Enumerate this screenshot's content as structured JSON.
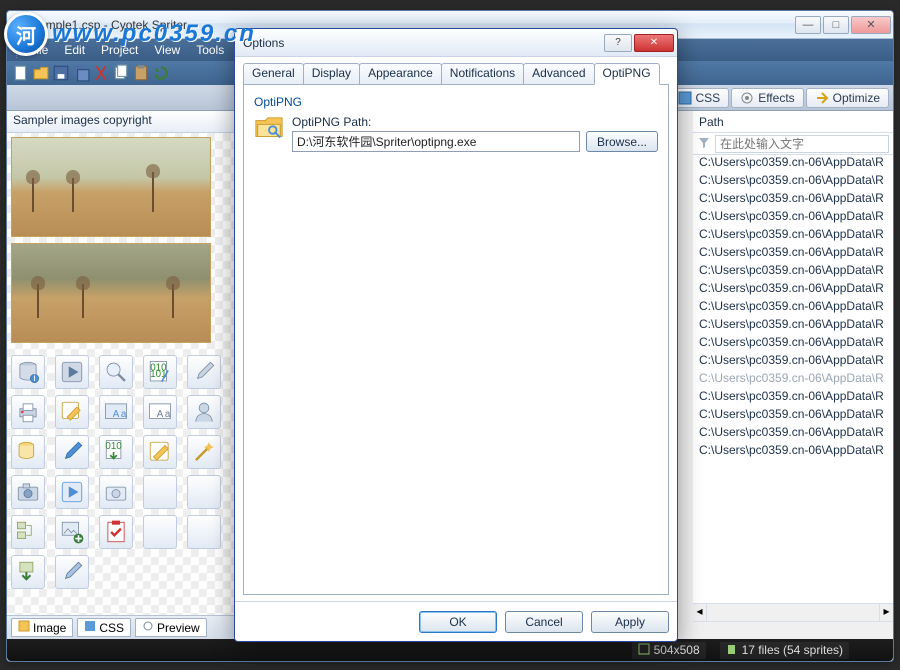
{
  "main_window": {
    "title": "sample1.csp - Cyotek Spriter",
    "win_min": "—",
    "win_max": "□",
    "win_close": "✕"
  },
  "watermark": {
    "url": "www.pc0359.cn",
    "logo_text": "河"
  },
  "menu": {
    "items": [
      "File",
      "Edit",
      "Project",
      "View",
      "Tools"
    ]
  },
  "ribbon": {
    "css": "CSS",
    "effects": "Effects",
    "optimize": "Optimize"
  },
  "left": {
    "panel_title": "Sampler images copyright",
    "tabs": {
      "image": "Image",
      "css": "CSS",
      "preview": "Preview"
    }
  },
  "right": {
    "header": "Path",
    "filter_placeholder": "在此处输入文字",
    "items": [
      {
        "text": "C:\\Users\\pc0359.cn-06\\AppData\\R"
      },
      {
        "text": "C:\\Users\\pc0359.cn-06\\AppData\\R"
      },
      {
        "text": "C:\\Users\\pc0359.cn-06\\AppData\\R"
      },
      {
        "text": "C:\\Users\\pc0359.cn-06\\AppData\\R"
      },
      {
        "text": "C:\\Users\\pc0359.cn-06\\AppData\\R"
      },
      {
        "text": "C:\\Users\\pc0359.cn-06\\AppData\\R"
      },
      {
        "text": "C:\\Users\\pc0359.cn-06\\AppData\\R"
      },
      {
        "text": "C:\\Users\\pc0359.cn-06\\AppData\\R"
      },
      {
        "text": "C:\\Users\\pc0359.cn-06\\AppData\\R"
      },
      {
        "text": "C:\\Users\\pc0359.cn-06\\AppData\\R"
      },
      {
        "text": "C:\\Users\\pc0359.cn-06\\AppData\\R"
      },
      {
        "text": "C:\\Users\\pc0359.cn-06\\AppData\\R"
      },
      {
        "text": "C:\\Users\\pc0359.cn-06\\AppData\\R",
        "dim": true
      },
      {
        "text": "C:\\Users\\pc0359.cn-06\\AppData\\R"
      },
      {
        "text": "C:\\Users\\pc0359.cn-06\\AppData\\R"
      },
      {
        "text": "C:\\Users\\pc0359.cn-06\\AppData\\R"
      },
      {
        "text": "C:\\Users\\pc0359.cn-06\\AppData\\R"
      }
    ]
  },
  "status": {
    "dim": "504x508",
    "files": "17 files (54 sprites)"
  },
  "dialog": {
    "title": "Options",
    "help": "?",
    "close": "✕",
    "tabs": [
      "General",
      "Display",
      "Appearance",
      "Notifications",
      "Advanced",
      "OptiPNG"
    ],
    "group": "OptiPNG",
    "path_label": "OptiPNG Path:",
    "path_value": "D:\\河东软件园\\Spriter\\optipng.exe",
    "browse": "Browse...",
    "ok": "OK",
    "cancel": "Cancel",
    "apply": "Apply"
  }
}
